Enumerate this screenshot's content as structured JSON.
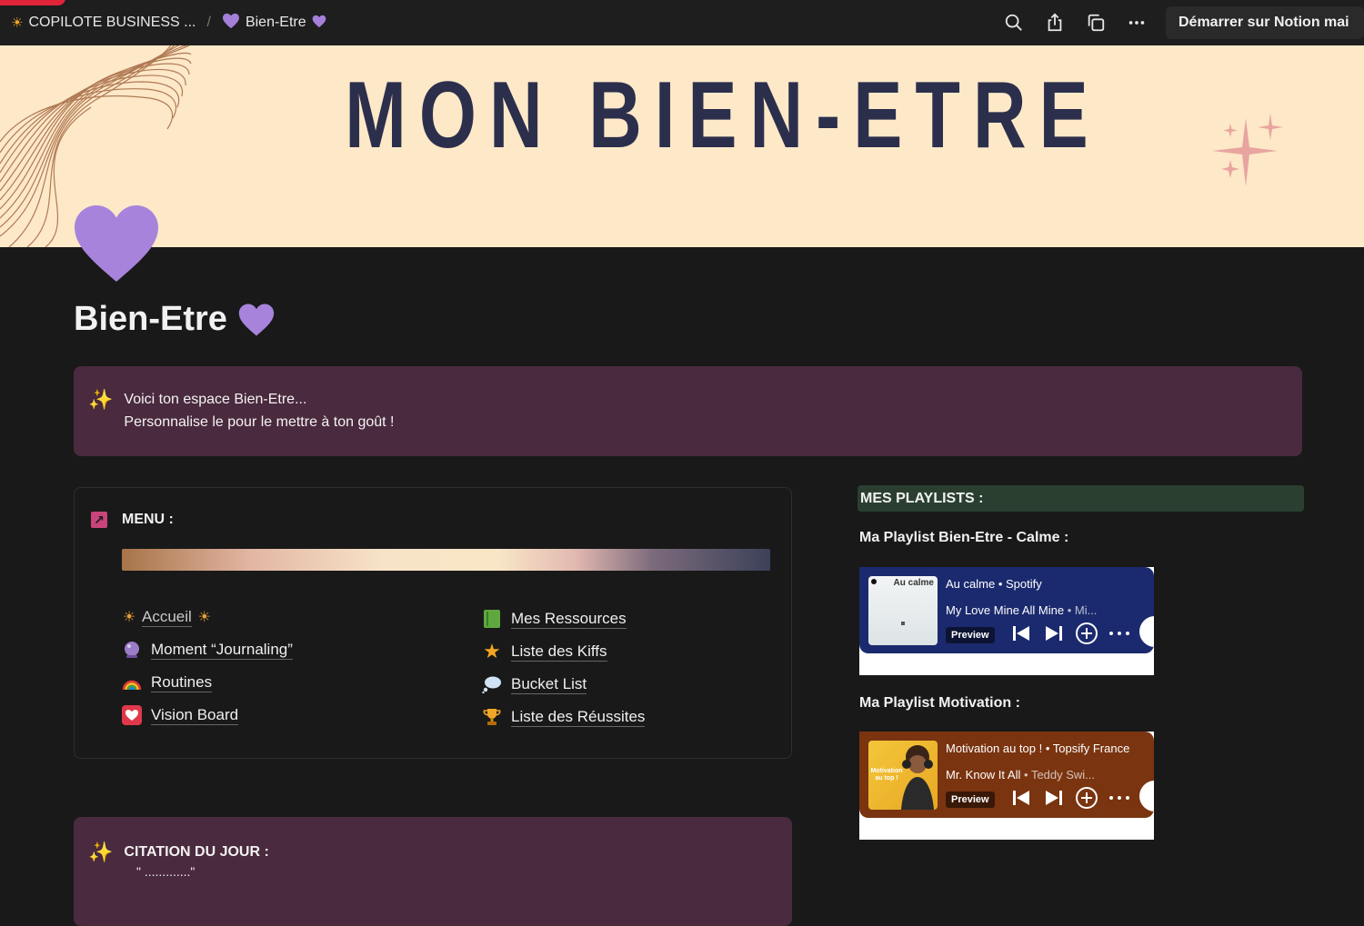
{
  "topbar": {
    "crumbs": [
      {
        "icon": "sun-icon",
        "label": "COPILOTE BUSINESS ..."
      },
      {
        "icon": "purple-heart-icon",
        "label": "Bien-Etre"
      }
    ],
    "cta_label": "Démarrer sur Notion mai"
  },
  "cover": {
    "title": "MON BIEN-ETRE"
  },
  "page": {
    "title": "Bien-Etre"
  },
  "callout": {
    "line1": "Voici ton espace Bien-Etre...",
    "line2": "Personnalise le pour le mettre à ton goût !"
  },
  "menu": {
    "heading": "MENU :",
    "left_items": [
      {
        "icon": "sun-icon",
        "label": "Accueil",
        "suffix_icon": "sun-icon"
      },
      {
        "icon": "crystal-ball-icon",
        "label": "Moment “Journaling”"
      },
      {
        "icon": "rainbow-icon",
        "label": "Routines"
      },
      {
        "icon": "heart-icon",
        "label": "Vision Board"
      }
    ],
    "right_items": [
      {
        "icon": "green-book-icon",
        "label": "Mes Ressources"
      },
      {
        "icon": "star-icon",
        "label": "Liste des Kiffs"
      },
      {
        "icon": "thought-bubble-icon",
        "label": "Bucket List"
      },
      {
        "icon": "trophy-icon",
        "label": "Liste des Réussites"
      }
    ]
  },
  "quote": {
    "heading": "CITATION DU JOUR  :",
    "body": "\" .............\""
  },
  "playlists": {
    "heading": "MES PLAYLISTS :",
    "calm": {
      "title": "Ma Playlist Bien-Etre - Calme :",
      "cover_text": "Au calme",
      "playlist": "Au calme",
      "owner": "Spotify",
      "track": "My Love Mine All Mine",
      "artist": "Mi...",
      "preview": "Preview",
      "color": "#1b2a6e"
    },
    "motivation": {
      "title": "Ma Playlist Motivation :",
      "cover_text": "Motivation au top !",
      "playlist": "Motivation au top !",
      "owner": "Topsify France",
      "track": "Mr. Know It All",
      "artist": "Teddy Swi...",
      "preview": "Preview",
      "color": "#7a3410"
    }
  }
}
